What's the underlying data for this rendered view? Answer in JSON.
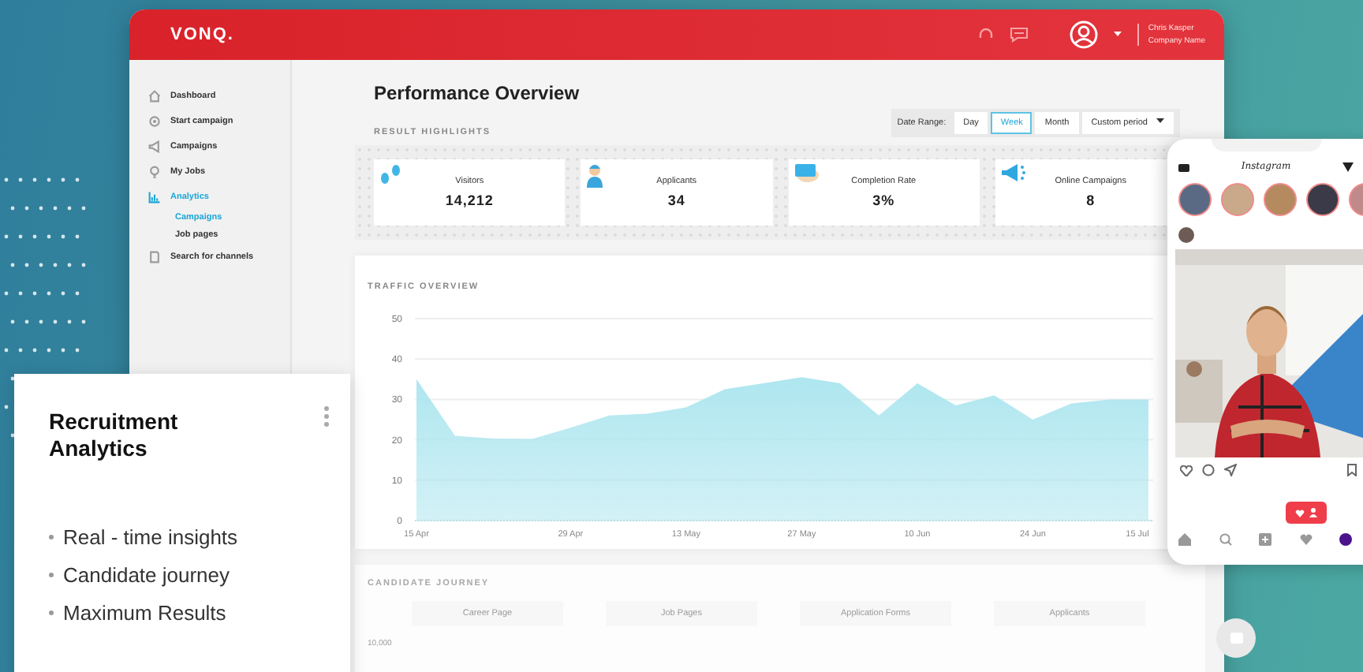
{
  "header": {
    "logo": "VONQ.",
    "user_name": "Chris Kasper",
    "company": "Company Name"
  },
  "sidebar": {
    "items": [
      {
        "label": "Dashboard",
        "selected": false
      },
      {
        "label": "Start campaign",
        "selected": false
      },
      {
        "label": "Campaigns",
        "selected": false
      },
      {
        "label": "My Jobs",
        "selected": false
      },
      {
        "label": "Analytics",
        "selected": true,
        "children": [
          {
            "label": "Campaigns",
            "selected": true
          },
          {
            "label": "Job pages",
            "selected": false
          }
        ]
      },
      {
        "label": "Search for channels",
        "selected": false
      }
    ]
  },
  "page": {
    "title": "Performance Overview",
    "section_label": "RESULT HIGHLIGHTS"
  },
  "date_range": {
    "label": "Date Range:",
    "options": [
      {
        "label": "Day",
        "selected": false
      },
      {
        "label": "Week",
        "selected": true
      },
      {
        "label": "Month",
        "selected": false
      }
    ],
    "custom": "Custom period"
  },
  "stats": [
    {
      "label": "Visitors",
      "value": "14,212"
    },
    {
      "label": "Applicants",
      "value": "34"
    },
    {
      "label": "Completion Rate",
      "value": "3%"
    },
    {
      "label": "Online Campaigns",
      "value": "8"
    }
  ],
  "traffic": {
    "title": "TRAFFIC OVERVIEW",
    "chart_data": {
      "type": "area",
      "categories": [
        "15 Apr",
        null,
        null,
        null,
        "29 Apr",
        null,
        null,
        "13 May",
        null,
        null,
        "27 May",
        null,
        null,
        "10 Jun",
        null,
        null,
        "24 Jun",
        null,
        null,
        "15 Jul"
      ],
      "series": [
        {
          "color": "#aee6ef",
          "values": [
            35,
            21,
            20.3,
            20.2,
            23,
            26,
            26.5,
            28,
            32.5,
            34,
            35.5,
            34,
            26,
            34,
            28.5,
            31,
            25,
            29,
            30,
            30
          ]
        }
      ],
      "grid": true,
      "ylim": [
        0,
        50
      ],
      "yticks": [
        0,
        10,
        20,
        30,
        40,
        50
      ]
    }
  },
  "journey": {
    "title": "CANDIDATE JOURNEY",
    "stages": [
      "Career Page",
      "Job Pages",
      "Application Forms",
      "Applicants"
    ],
    "y_label": "10,000"
  },
  "promo_card": {
    "title": "Recruitment Analytics",
    "bullets": [
      "Real - time insights",
      "Candidate journey",
      "Maximum Results"
    ]
  },
  "phone": {
    "app_title": "Instagram"
  }
}
